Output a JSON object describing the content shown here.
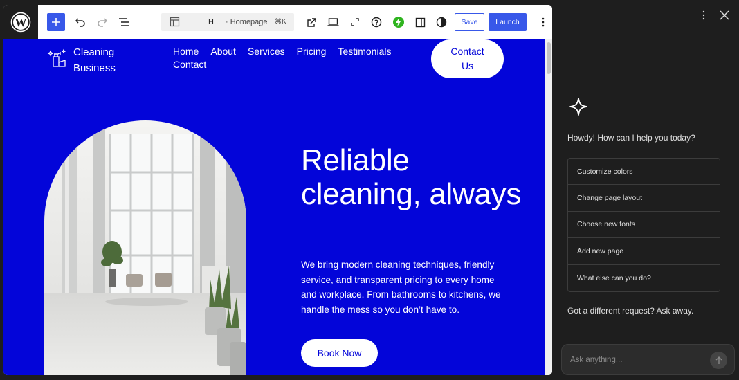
{
  "toolbar": {
    "breadcrumb_short": "H...",
    "breadcrumb_page": "· Homepage",
    "shortcut": "⌘K",
    "save_label": "Save",
    "launch_label": "Launch",
    "accent_color": "#3858e9"
  },
  "site": {
    "name": "Cleaning Business",
    "nav": [
      "Home",
      "About",
      "Services",
      "Pricing",
      "Testimonials",
      "Contact"
    ],
    "contact_button": "Contact Us",
    "hero_title": "Reliable cleaning, always",
    "hero_text": "We bring modern cleaning techniques, friendly service, and transparent pricing to every home and workplace. From bathrooms to kitchens, we handle the mess so you don’t have to.",
    "book_button": "Book Now",
    "brand_color": "#0305d9"
  },
  "assistant": {
    "greeting": "Howdy! How can I help you today?",
    "suggestions": [
      "Customize colors",
      "Change page layout",
      "Choose new fonts",
      "Add new page",
      "What else can you do?"
    ],
    "different_request": "Got a different request? Ask away.",
    "input_placeholder": "Ask anything..."
  }
}
